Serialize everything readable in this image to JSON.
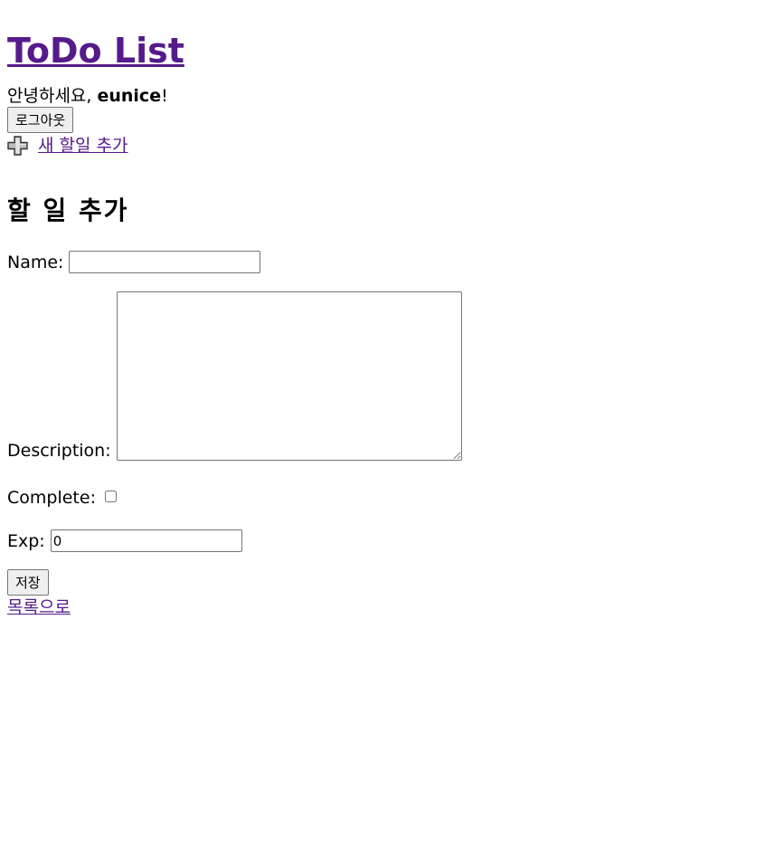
{
  "header": {
    "site_title": "ToDo List",
    "greeting_prefix": "안녕하세요, ",
    "username": "eunice",
    "greeting_suffix": "!",
    "logout_label": "로그아웃",
    "new_todo_label": " 새 할일 추가"
  },
  "form": {
    "heading": "할 일 추가",
    "name_label": "Name:",
    "name_value": "",
    "description_label": "Description:",
    "description_value": "",
    "complete_label": "Complete:",
    "complete_checked": false,
    "exp_label": "Exp:",
    "exp_value": "0",
    "save_label": "저장",
    "back_label": "목록으로"
  },
  "colors": {
    "link": "#551a8b",
    "text": "#000000",
    "background": "#ffffff"
  },
  "icons": {
    "new_todo_icon": "plus-icon"
  }
}
